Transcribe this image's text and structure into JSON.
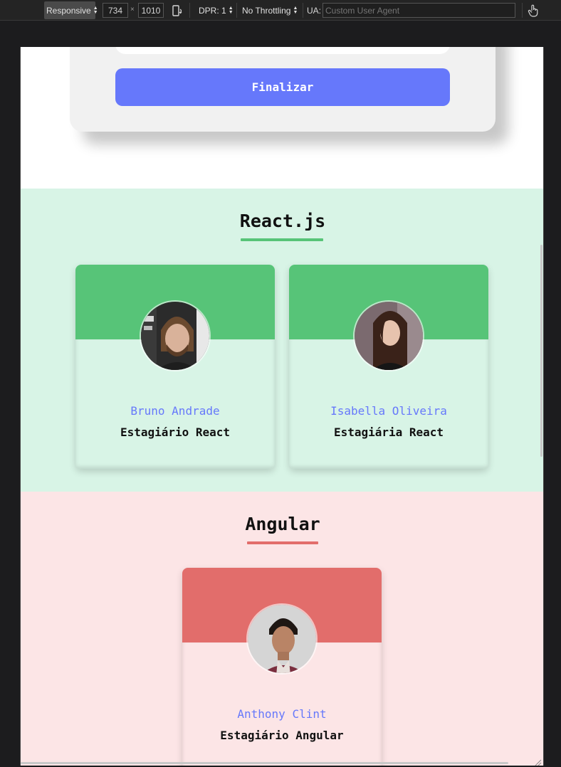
{
  "devtools": {
    "device_mode": "Responsive",
    "width": "734",
    "times": "×",
    "height": "1010",
    "dpr": "DPR: 1",
    "throttling": "No Throttling",
    "ua_label": "UA:",
    "ua_placeholder": "Custom User Agent"
  },
  "form": {
    "submit_label": "Finalizar"
  },
  "sections": [
    {
      "title": "React.js",
      "accent": "#57c478",
      "background": "#d8f4e6",
      "members": [
        {
          "name": "Bruno Andrade",
          "role": "Estagiário React"
        },
        {
          "name": "Isabella Oliveira",
          "role": "Estagiária React"
        }
      ]
    },
    {
      "title": "Angular",
      "accent": "#e26d6b",
      "background": "#fce5e6",
      "members": [
        {
          "name": "Anthony Clint",
          "role": "Estagiário Angular"
        }
      ]
    }
  ],
  "colors": {
    "button": "#6678fb",
    "name_text": "#6678fb",
    "form_card": "#f1f1f1"
  },
  "icons": [
    "rotate-icon",
    "touch-icon"
  ]
}
